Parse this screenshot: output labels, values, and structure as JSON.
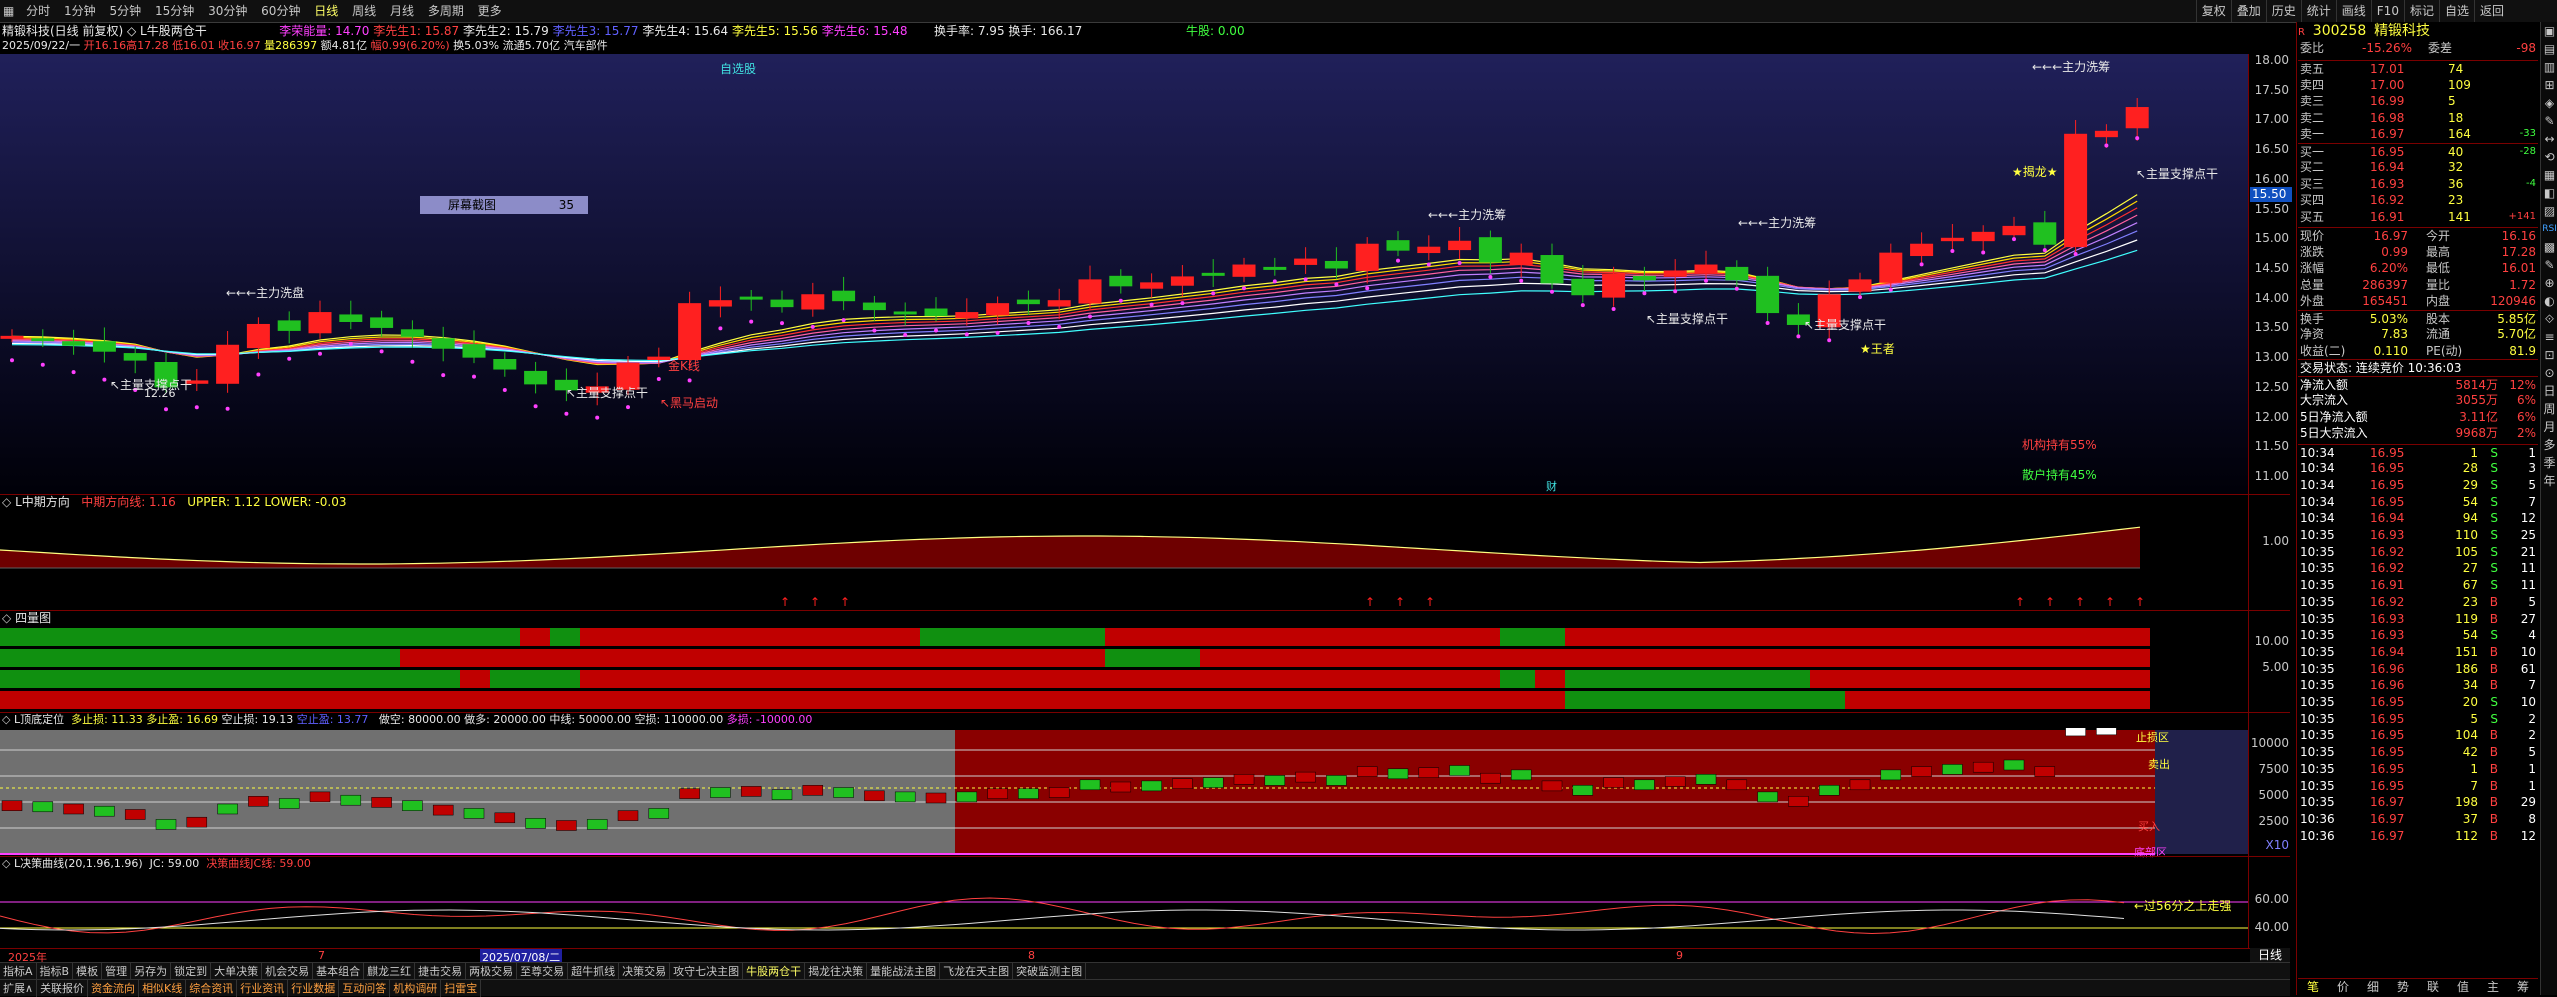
{
  "toolbar": {
    "left": [
      "分时",
      "1分钟",
      "5分钟",
      "15分钟",
      "30分钟",
      "60分钟",
      "日线",
      "周线",
      "月线",
      "多周期",
      "更多"
    ],
    "active": "日线",
    "right": [
      "复权",
      "叠加",
      "历史",
      "统计",
      "画线",
      "F10",
      "标记",
      "自选",
      "返回"
    ]
  },
  "info1": {
    "name": "精锻科技(日线 前复权)",
    "ind": "◇ L牛股两仓干",
    "a": "李荣能量: 14.70",
    "b": "李先生1: 15.87",
    "c": "李先生2: 15.79",
    "d": "李先生3: 15.77",
    "e": "李先生4: 15.64",
    "f": "李先生5: 15.56",
    "g": "李先生6: 15.48",
    "turn": "换手率: 7.95 换手: 166.17",
    "bull": "牛股: 0.00"
  },
  "info2": {
    "date": "2025/09/22/一",
    "open": "开16.16",
    "high": "高17.28",
    "low": "低16.01",
    "close": "收16.97",
    "vol": "量286397",
    "amt": "额4.81亿",
    "chg": "幅0.99(6.20%)",
    "turn": "换5.03%",
    "flow": "流通5.70亿",
    "sector": "汽车部件"
  },
  "main": {
    "ticks": [
      "18.00",
      "17.50",
      "17.00",
      "16.50",
      "16.00",
      "15.50",
      "15.00",
      "14.50",
      "14.00",
      "13.50",
      "13.00",
      "12.50",
      "12.00",
      "11.50",
      "11.00"
    ],
    "current": "15.50",
    "labels": {
      "zixuan": "自选股",
      "screenshot": "屏幕截图",
      "screenshot_num": "35",
      "zl1": "←←←主力洗盘",
      "zl2": "←←←主力洗筹",
      "zl3": "←←←主力洗筹",
      "zl4": "←←←主力洗筹",
      "zl5": "←←←主力洗筹",
      "zc1": "↖主量支撑点干",
      "zc2": "↖主量支撑点干",
      "zc3": "↖主量支撑点干",
      "zc4": "↖主量支撑点干",
      "zc5": "↖主量支撑点干",
      "low": "12.26",
      "jinkx": "金K线",
      "heima": "↖黑马启动",
      "tl": "★揭龙★",
      "wz": "★王者",
      "jg": "机构持有55%",
      "sh": "散户持有45%",
      "cai": "财"
    }
  },
  "p2": {
    "title": "L中期方向",
    "t1": "中期方向线: 1.16",
    "t2": "UPPER: 1.12  LOWER: -0.03",
    "tick": "1.00"
  },
  "p3": {
    "title": "四量图",
    "tick": "10.00",
    "tick2": "5.00"
  },
  "p4": {
    "title": "L顶底定位",
    "a": "多止损: 11.33",
    "b": "多止盈: 16.69",
    "c": "空止损: 19.13",
    "d": "空止盈: 13.77",
    "e": "做空: 80000.00",
    "f": "做多: 20000.00",
    "g": "中线: 50000.00",
    "h": "空损: 110000.00",
    "i": "多损: -10000.00",
    "ticks": [
      "10000",
      "7500",
      "5000",
      "2500"
    ],
    "l1": "止损区",
    "l2": "卖出",
    "l3": "买入",
    "l4": "底部区",
    "x10": "X10"
  },
  "p5": {
    "title": "L决策曲线(20,1.96,1.96)",
    "jc": "JC: 59.00",
    "t": "决策曲线JC线: 59.00",
    "ticks": [
      "60.00",
      "40.00"
    ],
    "note": "←过56分之上走强"
  },
  "dates": {
    "a": "2025年",
    "b": "7",
    "c": "2025/07/08/二",
    "d": "8",
    "e": "9",
    "right": "日线"
  },
  "bottom1": [
    "指标A",
    "指标B",
    "模板",
    "管理",
    "另存为",
    "锁定到",
    "大单决策",
    "机会交易",
    "基本组合",
    "麒龙三红",
    "捷击交易",
    "两极交易",
    "至尊交易",
    "超牛抓线",
    "决策交易",
    "攻守七决主图",
    "牛股两仓干",
    "揭龙往决策",
    "量能战法主图",
    "飞龙在天主图",
    "突破监测主图"
  ],
  "bottom1_active": "牛股两仓干",
  "bottom2": [
    "扩展∧",
    "关联报价",
    "资金流向",
    "相似K线",
    "综合资讯",
    "行业资讯",
    "行业数据",
    "互动问答",
    "机构调研",
    "扫雷宝"
  ],
  "right_panel": {
    "code": "300258",
    "name": "精锻科技",
    "wb": "委比",
    "wb_v": "-15.26%",
    "wc": "委差",
    "wc_v": "-98",
    "sells": [
      {
        "l": "卖五",
        "p": "17.01",
        "v": "74"
      },
      {
        "l": "卖四",
        "p": "17.00",
        "v": "109"
      },
      {
        "l": "卖三",
        "p": "16.99",
        "v": "5"
      },
      {
        "l": "卖二",
        "p": "16.98",
        "v": "18"
      },
      {
        "l": "卖一",
        "p": "16.97",
        "v": "164",
        "d": "-33"
      }
    ],
    "buys": [
      {
        "l": "买一",
        "p": "16.95",
        "v": "40",
        "d": "-28"
      },
      {
        "l": "买二",
        "p": "16.94",
        "v": "32",
        "d": ""
      },
      {
        "l": "买三",
        "p": "16.93",
        "v": "36",
        "d": "-4"
      },
      {
        "l": "买四",
        "p": "16.92",
        "v": "23",
        "d": ""
      },
      {
        "l": "买五",
        "p": "16.91",
        "v": "141",
        "d": "+141"
      }
    ],
    "stats": [
      {
        "a": "现价",
        "b": "16.97",
        "c": "今开",
        "d": "16.16"
      },
      {
        "a": "涨跌",
        "b": "0.99",
        "c": "最高",
        "d": "17.28"
      },
      {
        "a": "涨幅",
        "b": "6.20%",
        "c": "最低",
        "d": "16.01"
      },
      {
        "a": "总量",
        "b": "286397",
        "c": "量比",
        "d": "1.72"
      },
      {
        "a": "外盘",
        "b": "165451",
        "c": "内盘",
        "d": "120946"
      }
    ],
    "stats2": [
      {
        "a": "换手",
        "b": "5.03%",
        "c": "股本",
        "d": "5.85亿"
      },
      {
        "a": "净资",
        "b": "7.83",
        "c": "流通",
        "d": "5.70亿"
      },
      {
        "a": "收益(二)",
        "b": "0.110",
        "c": "PE(动)",
        "d": "81.9"
      }
    ],
    "state": "交易状态: 连续竞价 10:36:03",
    "flows": [
      {
        "a": "净流入额",
        "b": "5814万",
        "c": "12%"
      },
      {
        "a": "大宗流入",
        "b": "3055万",
        "c": "6%"
      },
      {
        "a": "5日净流入额",
        "b": "3.11亿",
        "c": "6%"
      },
      {
        "a": "5日大宗流入",
        "b": "9968万",
        "c": "2%"
      }
    ],
    "ticks": [
      {
        "t": "10:34",
        "p": "16.95",
        "v": "1",
        "s": "S",
        "n": "1"
      },
      {
        "t": "10:34",
        "p": "16.95",
        "v": "28",
        "s": "S",
        "n": "3"
      },
      {
        "t": "10:34",
        "p": "16.95",
        "v": "29",
        "s": "S",
        "n": "5"
      },
      {
        "t": "10:34",
        "p": "16.95",
        "v": "54",
        "s": "S",
        "n": "7"
      },
      {
        "t": "10:34",
        "p": "16.94",
        "v": "94",
        "s": "S",
        "n": "12"
      },
      {
        "t": "10:35",
        "p": "16.93",
        "v": "110",
        "s": "S",
        "n": "25"
      },
      {
        "t": "10:35",
        "p": "16.92",
        "v": "105",
        "s": "S",
        "n": "21"
      },
      {
        "t": "10:35",
        "p": "16.92",
        "v": "27",
        "s": "S",
        "n": "11"
      },
      {
        "t": "10:35",
        "p": "16.91",
        "v": "67",
        "s": "S",
        "n": "11"
      },
      {
        "t": "10:35",
        "p": "16.92",
        "v": "23",
        "s": "B",
        "n": "5"
      },
      {
        "t": "10:35",
        "p": "16.93",
        "v": "119",
        "s": "B",
        "n": "27"
      },
      {
        "t": "10:35",
        "p": "16.93",
        "v": "54",
        "s": "S",
        "n": "4"
      },
      {
        "t": "10:35",
        "p": "16.94",
        "v": "151",
        "s": "B",
        "n": "10"
      },
      {
        "t": "10:35",
        "p": "16.96",
        "v": "186",
        "s": "B",
        "n": "61"
      },
      {
        "t": "10:35",
        "p": "16.96",
        "v": "34",
        "s": "B",
        "n": "7"
      },
      {
        "t": "10:35",
        "p": "16.95",
        "v": "20",
        "s": "S",
        "n": "10"
      },
      {
        "t": "10:35",
        "p": "16.95",
        "v": "5",
        "s": "S",
        "n": "2"
      },
      {
        "t": "10:35",
        "p": "16.95",
        "v": "104",
        "s": "B",
        "n": "2"
      },
      {
        "t": "10:35",
        "p": "16.95",
        "v": "42",
        "s": "B",
        "n": "5"
      },
      {
        "t": "10:35",
        "p": "16.95",
        "v": "1",
        "s": "B",
        "n": "1"
      },
      {
        "t": "10:35",
        "p": "16.95",
        "v": "7",
        "s": "B",
        "n": "1"
      },
      {
        "t": "10:35",
        "p": "16.97",
        "v": "198",
        "s": "B",
        "n": "29"
      },
      {
        "t": "10:36",
        "p": "16.97",
        "v": "37",
        "s": "B",
        "n": "8"
      },
      {
        "t": "10:36",
        "p": "16.97",
        "v": "112",
        "s": "B",
        "n": "12"
      }
    ],
    "tabs": [
      "笔",
      "价",
      "细",
      "势",
      "联",
      "值",
      "主",
      "筹"
    ]
  },
  "vert_tabs": [
    "RSI",
    "日",
    "周",
    "月",
    "多",
    "季",
    "年"
  ]
}
